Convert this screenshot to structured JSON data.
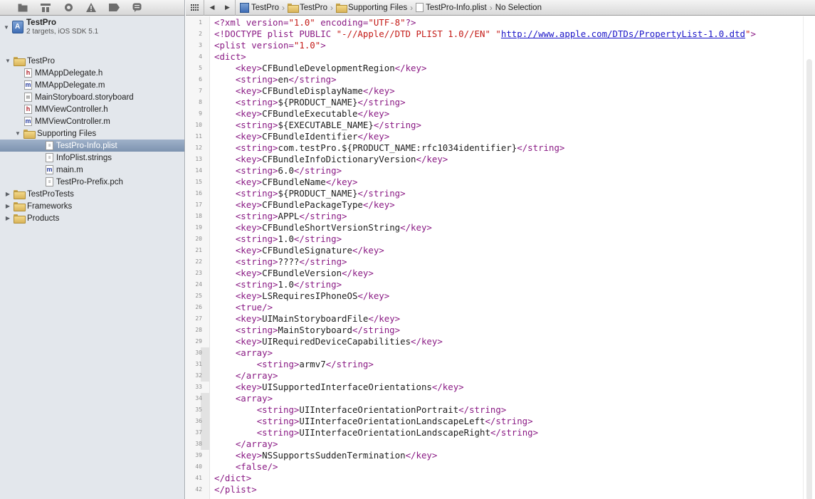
{
  "navigator": {
    "toolbar_icons": [
      "project-navigator-icon",
      "symbol-navigator-icon",
      "search-navigator-icon",
      "issue-navigator-icon",
      "breakpoint-navigator-icon",
      "log-navigator-icon"
    ],
    "project": {
      "name": "TestPro",
      "subtitle": "2 targets, iOS SDK 5.1"
    },
    "tree": [
      {
        "label": "TestPro",
        "kind": "folder",
        "depth": 1,
        "disclosure": "open"
      },
      {
        "label": "MMAppDelegate.h",
        "kind": "h",
        "depth": 2
      },
      {
        "label": "MMAppDelegate.m",
        "kind": "m",
        "depth": 2
      },
      {
        "label": "MainStoryboard.storyboard",
        "kind": "sb",
        "depth": 2
      },
      {
        "label": "MMViewController.h",
        "kind": "h",
        "depth": 2
      },
      {
        "label": "MMViewController.m",
        "kind": "m",
        "depth": 2
      },
      {
        "label": "Supporting Files",
        "kind": "folder",
        "depth": 2,
        "disclosure": "open"
      },
      {
        "label": "TestPro-Info.plist",
        "kind": "plist",
        "depth": 3,
        "selected": true
      },
      {
        "label": "InfoPlist.strings",
        "kind": "strings",
        "depth": 3
      },
      {
        "label": "main.m",
        "kind": "m",
        "depth": 3
      },
      {
        "label": "TestPro-Prefix.pch",
        "kind": "pch",
        "depth": 3
      },
      {
        "label": "TestProTests",
        "kind": "folder",
        "depth": 1,
        "disclosure": "closed"
      },
      {
        "label": "Frameworks",
        "kind": "folder",
        "depth": 1,
        "disclosure": "closed"
      },
      {
        "label": "Products",
        "kind": "folder",
        "depth": 1,
        "disclosure": "closed"
      }
    ]
  },
  "jumpbar": {
    "crumbs": [
      {
        "label": "TestPro",
        "icon": "project"
      },
      {
        "label": "TestPro",
        "icon": "folder"
      },
      {
        "label": "Supporting Files",
        "icon": "folder"
      },
      {
        "label": "TestPro-Info.plist",
        "icon": "doc"
      },
      {
        "label": "No Selection",
        "icon": "none"
      }
    ]
  },
  "editor": {
    "lines": [
      "<?xml version=\"1.0\" encoding=\"UTF-8\"?>",
      "<!DOCTYPE plist PUBLIC \"-//Apple//DTD PLIST 1.0//EN\" \"http://www.apple.com/DTDs/PropertyList-1.0.dtd\">",
      "<plist version=\"1.0\">",
      "<dict>",
      "    <key>CFBundleDevelopmentRegion</key>",
      "    <string>en</string>",
      "    <key>CFBundleDisplayName</key>",
      "    <string>${PRODUCT_NAME}</string>",
      "    <key>CFBundleExecutable</key>",
      "    <string>${EXECUTABLE_NAME}</string>",
      "    <key>CFBundleIdentifier</key>",
      "    <string>com.testPro.${PRODUCT_NAME:rfc1034identifier}</string>",
      "    <key>CFBundleInfoDictionaryVersion</key>",
      "    <string>6.0</string>",
      "    <key>CFBundleName</key>",
      "    <string>${PRODUCT_NAME}</string>",
      "    <key>CFBundlePackageType</key>",
      "    <string>APPL</string>",
      "    <key>CFBundleShortVersionString</key>",
      "    <string>1.0</string>",
      "    <key>CFBundleSignature</key>",
      "    <string>????</string>",
      "    <key>CFBundleVersion</key>",
      "    <string>1.0</string>",
      "    <key>LSRequiresIPhoneOS</key>",
      "    <true/>",
      "    <key>UIMainStoryboardFile</key>",
      "    <string>MainStoryboard</string>",
      "    <key>UIRequiredDeviceCapabilities</key>",
      "    <array>",
      "        <string>armv7</string>",
      "    </array>",
      "    <key>UISupportedInterfaceOrientations</key>",
      "    <array>",
      "        <string>UIInterfaceOrientationPortrait</string>",
      "        <string>UIInterfaceOrientationLandscapeLeft</string>",
      "        <string>UIInterfaceOrientationLandscapeRight</string>",
      "    </array>",
      "    <key>NSSupportsSuddenTermination</key>",
      "    <false/>",
      "</dict>",
      "</plist>"
    ],
    "folded_band_lines": [
      30,
      31,
      32,
      34,
      35,
      36,
      37,
      38
    ],
    "colors": {
      "tag": "#8a1a84",
      "value": "#c41a16",
      "url": "#1a14c8",
      "text": "#1c1c1c"
    }
  }
}
